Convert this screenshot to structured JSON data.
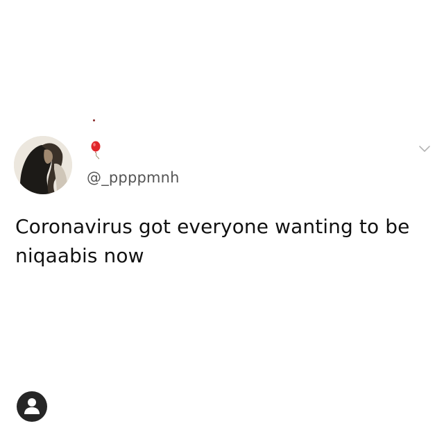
{
  "tweet": {
    "handle": "@_ppppmnh",
    "text": "Coronavirus got everyone wanting to be niqaabis now",
    "avatar": "user-avatar-photo",
    "name_emoji": "red-balloon-icon",
    "menu_icon": "chevron-down-icon"
  },
  "overlay": {
    "profile_icon": "person-icon"
  },
  "colors": {
    "background": "#ffffff",
    "text": "#111111",
    "handle": "#555555",
    "chevron": "#b5b5b5",
    "badge": "#262626",
    "balloon": "#e0262b"
  }
}
